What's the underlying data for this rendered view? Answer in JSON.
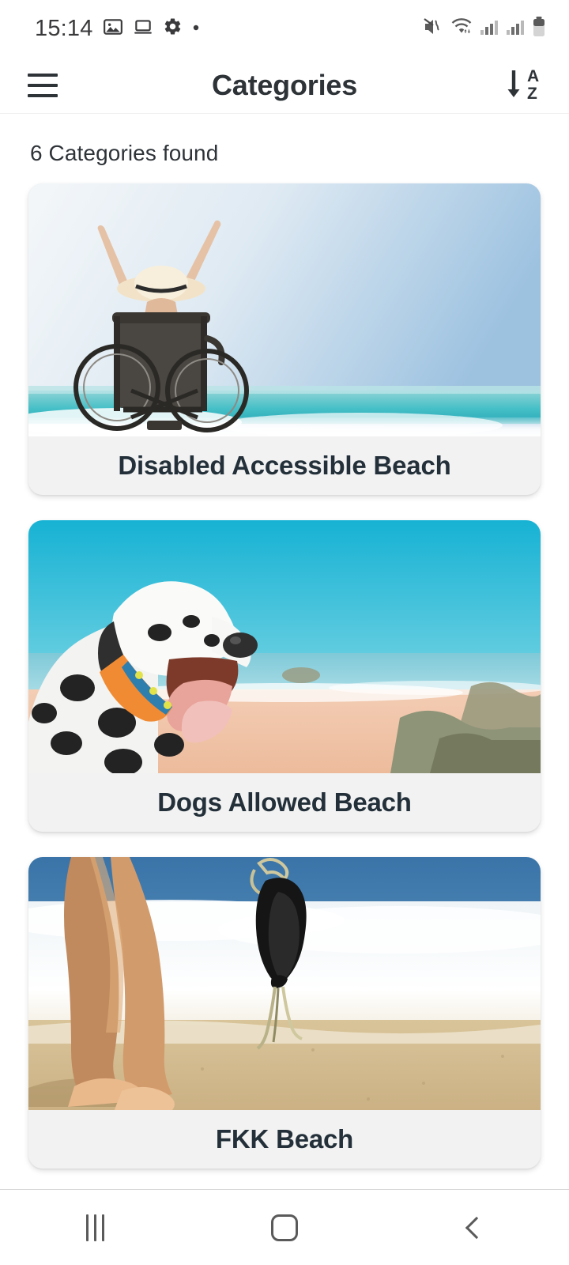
{
  "status_bar": {
    "time": "15:14",
    "left_icons": [
      "image-icon",
      "laptop-icon",
      "gear-icon",
      "dot-icon"
    ],
    "right_icons": [
      "mute-vibrate-icon",
      "wifi-icon",
      "signal-1-icon",
      "signal-2-icon",
      "battery-icon"
    ]
  },
  "app_bar": {
    "menu_icon": "hamburger-menu-icon",
    "title": "Categories",
    "sort_icon": "sort-a-z-icon",
    "sort_letter_top": "A",
    "sort_letter_bottom": "Z"
  },
  "main": {
    "result_count_text": "6 Categories found",
    "cards": [
      {
        "title": "Disabled Accessible Beach",
        "image_name": "wheelchair-beach-photo",
        "image_alt": "Woman in wheelchair with arms raised facing the ocean"
      },
      {
        "title": "Dogs Allowed Beach",
        "image_name": "dalmatian-beach-photo",
        "image_alt": "Dalmatian dog with orange collar on a sandy beach"
      },
      {
        "title": "FKK Beach",
        "image_name": "bikini-beach-photo",
        "image_alt": "Legs walking on sand holding a black bikini near the surf"
      }
    ]
  },
  "nav_bar": {
    "recents_label": "recents-button",
    "home_label": "home-button",
    "back_label": "back-button"
  },
  "colors": {
    "text_primary": "#2e3338",
    "card_bg": "#f2f2f2",
    "page_bg": "#ffffff",
    "icon_gray": "#5a5a5a"
  }
}
